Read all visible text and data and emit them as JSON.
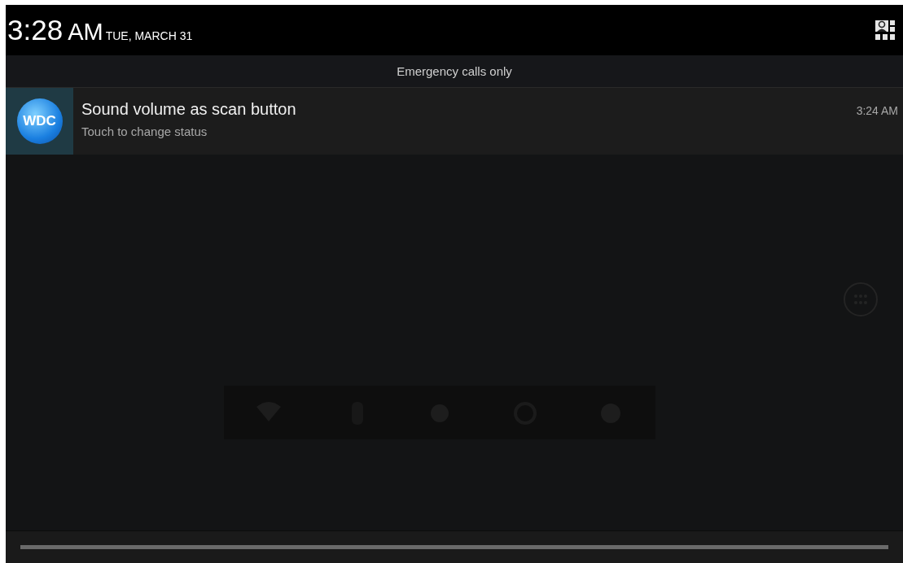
{
  "header": {
    "clock": "3:28",
    "ampm": "AM",
    "date": "TUE, MARCH 31"
  },
  "carrier_label": "Emergency calls only",
  "notifications": [
    {
      "app_logo_text": "WDC",
      "title": "Sound volume as scan button",
      "text": "Touch to change status",
      "time": "3:24 AM"
    }
  ]
}
